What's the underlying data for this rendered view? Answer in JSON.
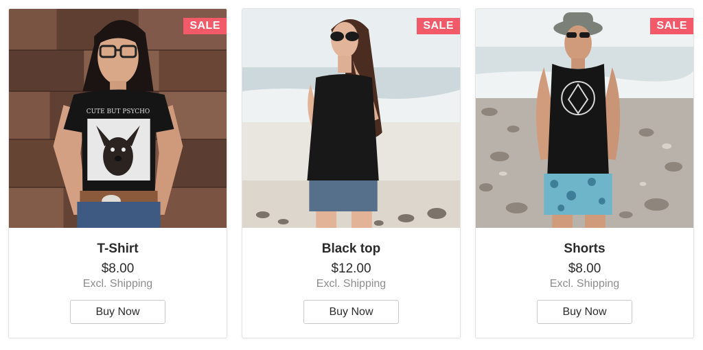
{
  "products": [
    {
      "name": "T-Shirt",
      "price": "$8.00",
      "shipping": "Excl. Shipping",
      "badge": "SALE",
      "button": "Buy Now",
      "shirt_print": "CUTE BUT PSYCHO"
    },
    {
      "name": "Black top",
      "price": "$12.00",
      "shipping": "Excl. Shipping",
      "badge": "SALE",
      "button": "Buy Now"
    },
    {
      "name": "Shorts",
      "price": "$8.00",
      "shipping": "Excl. Shipping",
      "badge": "SALE",
      "button": "Buy Now"
    }
  ],
  "colors": {
    "badge": "#f25a6a",
    "text": "#2b2b2b",
    "muted": "#8c8c8c",
    "border": "#e3e3e3"
  }
}
